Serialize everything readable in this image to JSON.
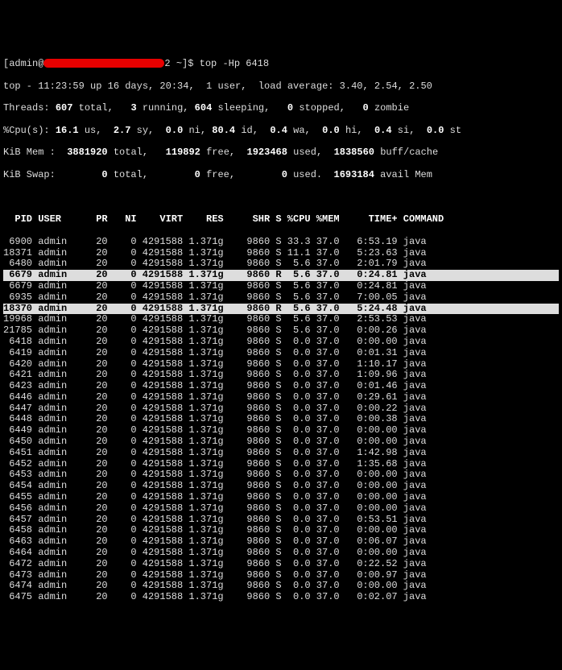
{
  "prompt": {
    "userhost": "[admin@",
    "tail": "2 ~]$ ",
    "cmd": "top -Hp 6418"
  },
  "summary": {
    "line1_a": "top - 11:23:59 up 16 days, 20:34,  1 user,  load average: 3.40, 2.54, 2.50",
    "threads_label": "Threads:",
    "threads_parts": {
      "total": "607",
      "total_l": "total,",
      "running": "3",
      "running_l": "running,",
      "sleeping": "604",
      "sleeping_l": "sleeping,",
      "stopped": "0",
      "stopped_l": "stopped,",
      "zombie": "0",
      "zombie_l": "zombie"
    },
    "cpu_label": "%Cpu(s):",
    "cpu_parts": {
      "us": "16.1",
      "us_l": "us,",
      "sy": "2.7",
      "sy_l": "sy,",
      "ni": "0.0",
      "ni_l": "ni,",
      "id": "80.4",
      "id_l": "id,",
      "wa": "0.4",
      "wa_l": "wa,",
      "hi": "0.0",
      "hi_l": "hi,",
      "si": "0.4",
      "si_l": "si,",
      "st": "0.0",
      "st_l": "st"
    },
    "mem_label": "KiB Mem :",
    "mem_parts": {
      "total": "3881920",
      "total_l": "total,",
      "free": "119892",
      "free_l": "free,",
      "used": "1923468",
      "used_l": "used,",
      "buff": "1838560",
      "buff_l": "buff/cache"
    },
    "swap_label": "KiB Swap:",
    "swap_parts": {
      "total": "0",
      "total_l": "total,",
      "free": "0",
      "free_l": "free,",
      "used": "0",
      "used_l": "used.",
      "avail": "1693184",
      "avail_l": "avail Mem"
    }
  },
  "columns": {
    "pid": "PID",
    "user": "USER",
    "pr": "PR",
    "ni": "NI",
    "virt": "VIRT",
    "res": "RES",
    "shr": "SHR",
    "s": "S",
    "cpu": "%CPU",
    "mem": "%MEM",
    "time": "TIME+",
    "cmd": "COMMAND"
  },
  "rows": [
    {
      "pid": "6900",
      "user": "admin",
      "pr": "20",
      "ni": "0",
      "virt": "4291588",
      "res": "1.371g",
      "shr": "9860",
      "s": "S",
      "cpu": "33.3",
      "mem": "37.0",
      "time": "6:53.19",
      "cmd": "java",
      "hl": false
    },
    {
      "pid": "18371",
      "user": "admin",
      "pr": "20",
      "ni": "0",
      "virt": "4291588",
      "res": "1.371g",
      "shr": "9860",
      "s": "S",
      "cpu": "11.1",
      "mem": "37.0",
      "time": "5:23.63",
      "cmd": "java",
      "hl": false
    },
    {
      "pid": "6480",
      "user": "admin",
      "pr": "20",
      "ni": "0",
      "virt": "4291588",
      "res": "1.371g",
      "shr": "9860",
      "s": "S",
      "cpu": "5.6",
      "mem": "37.0",
      "time": "2:01.79",
      "cmd": "java",
      "hl": false
    },
    {
      "pid": "6679",
      "user": "admin",
      "pr": "20",
      "ni": "0",
      "virt": "4291588",
      "res": "1.371g",
      "shr": "9860",
      "s": "R",
      "cpu": "5.6",
      "mem": "37.0",
      "time": "0:24.81",
      "cmd": "java",
      "hl": true
    },
    {
      "pid": "6679",
      "user": "admin",
      "pr": "20",
      "ni": "0",
      "virt": "4291588",
      "res": "1.371g",
      "shr": "9860",
      "s": "S",
      "cpu": "5.6",
      "mem": "37.0",
      "time": "0:24.81",
      "cmd": "java",
      "hl": false
    },
    {
      "pid": "6935",
      "user": "admin",
      "pr": "20",
      "ni": "0",
      "virt": "4291588",
      "res": "1.371g",
      "shr": "9860",
      "s": "S",
      "cpu": "5.6",
      "mem": "37.0",
      "time": "7:00.05",
      "cmd": "java",
      "hl": false
    },
    {
      "pid": "18370",
      "user": "admin",
      "pr": "20",
      "ni": "0",
      "virt": "4291588",
      "res": "1.371g",
      "shr": "9860",
      "s": "R",
      "cpu": "5.6",
      "mem": "37.0",
      "time": "5:24.48",
      "cmd": "java",
      "hl": true
    },
    {
      "pid": "19968",
      "user": "admin",
      "pr": "20",
      "ni": "0",
      "virt": "4291588",
      "res": "1.371g",
      "shr": "9860",
      "s": "S",
      "cpu": "5.6",
      "mem": "37.0",
      "time": "2:53.53",
      "cmd": "java",
      "hl": false
    },
    {
      "pid": "21785",
      "user": "admin",
      "pr": "20",
      "ni": "0",
      "virt": "4291588",
      "res": "1.371g",
      "shr": "9860",
      "s": "S",
      "cpu": "5.6",
      "mem": "37.0",
      "time": "0:00.26",
      "cmd": "java",
      "hl": false
    },
    {
      "pid": "6418",
      "user": "admin",
      "pr": "20",
      "ni": "0",
      "virt": "4291588",
      "res": "1.371g",
      "shr": "9860",
      "s": "S",
      "cpu": "0.0",
      "mem": "37.0",
      "time": "0:00.00",
      "cmd": "java",
      "hl": false
    },
    {
      "pid": "6419",
      "user": "admin",
      "pr": "20",
      "ni": "0",
      "virt": "4291588",
      "res": "1.371g",
      "shr": "9860",
      "s": "S",
      "cpu": "0.0",
      "mem": "37.0",
      "time": "0:01.31",
      "cmd": "java",
      "hl": false
    },
    {
      "pid": "6420",
      "user": "admin",
      "pr": "20",
      "ni": "0",
      "virt": "4291588",
      "res": "1.371g",
      "shr": "9860",
      "s": "S",
      "cpu": "0.0",
      "mem": "37.0",
      "time": "1:10.17",
      "cmd": "java",
      "hl": false
    },
    {
      "pid": "6421",
      "user": "admin",
      "pr": "20",
      "ni": "0",
      "virt": "4291588",
      "res": "1.371g",
      "shr": "9860",
      "s": "S",
      "cpu": "0.0",
      "mem": "37.0",
      "time": "1:09.96",
      "cmd": "java",
      "hl": false
    },
    {
      "pid": "6423",
      "user": "admin",
      "pr": "20",
      "ni": "0",
      "virt": "4291588",
      "res": "1.371g",
      "shr": "9860",
      "s": "S",
      "cpu": "0.0",
      "mem": "37.0",
      "time": "0:01.46",
      "cmd": "java",
      "hl": false
    },
    {
      "pid": "6446",
      "user": "admin",
      "pr": "20",
      "ni": "0",
      "virt": "4291588",
      "res": "1.371g",
      "shr": "9860",
      "s": "S",
      "cpu": "0.0",
      "mem": "37.0",
      "time": "0:29.61",
      "cmd": "java",
      "hl": false
    },
    {
      "pid": "6447",
      "user": "admin",
      "pr": "20",
      "ni": "0",
      "virt": "4291588",
      "res": "1.371g",
      "shr": "9860",
      "s": "S",
      "cpu": "0.0",
      "mem": "37.0",
      "time": "0:00.22",
      "cmd": "java",
      "hl": false
    },
    {
      "pid": "6448",
      "user": "admin",
      "pr": "20",
      "ni": "0",
      "virt": "4291588",
      "res": "1.371g",
      "shr": "9860",
      "s": "S",
      "cpu": "0.0",
      "mem": "37.0",
      "time": "0:00.38",
      "cmd": "java",
      "hl": false
    },
    {
      "pid": "6449",
      "user": "admin",
      "pr": "20",
      "ni": "0",
      "virt": "4291588",
      "res": "1.371g",
      "shr": "9860",
      "s": "S",
      "cpu": "0.0",
      "mem": "37.0",
      "time": "0:00.00",
      "cmd": "java",
      "hl": false
    },
    {
      "pid": "6450",
      "user": "admin",
      "pr": "20",
      "ni": "0",
      "virt": "4291588",
      "res": "1.371g",
      "shr": "9860",
      "s": "S",
      "cpu": "0.0",
      "mem": "37.0",
      "time": "0:00.00",
      "cmd": "java",
      "hl": false
    },
    {
      "pid": "6451",
      "user": "admin",
      "pr": "20",
      "ni": "0",
      "virt": "4291588",
      "res": "1.371g",
      "shr": "9860",
      "s": "S",
      "cpu": "0.0",
      "mem": "37.0",
      "time": "1:42.98",
      "cmd": "java",
      "hl": false
    },
    {
      "pid": "6452",
      "user": "admin",
      "pr": "20",
      "ni": "0",
      "virt": "4291588",
      "res": "1.371g",
      "shr": "9860",
      "s": "S",
      "cpu": "0.0",
      "mem": "37.0",
      "time": "1:35.68",
      "cmd": "java",
      "hl": false
    },
    {
      "pid": "6453",
      "user": "admin",
      "pr": "20",
      "ni": "0",
      "virt": "4291588",
      "res": "1.371g",
      "shr": "9860",
      "s": "S",
      "cpu": "0.0",
      "mem": "37.0",
      "time": "0:00.00",
      "cmd": "java",
      "hl": false
    },
    {
      "pid": "6454",
      "user": "admin",
      "pr": "20",
      "ni": "0",
      "virt": "4291588",
      "res": "1.371g",
      "shr": "9860",
      "s": "S",
      "cpu": "0.0",
      "mem": "37.0",
      "time": "0:00.00",
      "cmd": "java",
      "hl": false
    },
    {
      "pid": "6455",
      "user": "admin",
      "pr": "20",
      "ni": "0",
      "virt": "4291588",
      "res": "1.371g",
      "shr": "9860",
      "s": "S",
      "cpu": "0.0",
      "mem": "37.0",
      "time": "0:00.00",
      "cmd": "java",
      "hl": false
    },
    {
      "pid": "6456",
      "user": "admin",
      "pr": "20",
      "ni": "0",
      "virt": "4291588",
      "res": "1.371g",
      "shr": "9860",
      "s": "S",
      "cpu": "0.0",
      "mem": "37.0",
      "time": "0:00.00",
      "cmd": "java",
      "hl": false
    },
    {
      "pid": "6457",
      "user": "admin",
      "pr": "20",
      "ni": "0",
      "virt": "4291588",
      "res": "1.371g",
      "shr": "9860",
      "s": "S",
      "cpu": "0.0",
      "mem": "37.0",
      "time": "0:53.51",
      "cmd": "java",
      "hl": false
    },
    {
      "pid": "6458",
      "user": "admin",
      "pr": "20",
      "ni": "0",
      "virt": "4291588",
      "res": "1.371g",
      "shr": "9860",
      "s": "S",
      "cpu": "0.0",
      "mem": "37.0",
      "time": "0:00.00",
      "cmd": "java",
      "hl": false
    },
    {
      "pid": "6463",
      "user": "admin",
      "pr": "20",
      "ni": "0",
      "virt": "4291588",
      "res": "1.371g",
      "shr": "9860",
      "s": "S",
      "cpu": "0.0",
      "mem": "37.0",
      "time": "0:06.07",
      "cmd": "java",
      "hl": false
    },
    {
      "pid": "6464",
      "user": "admin",
      "pr": "20",
      "ni": "0",
      "virt": "4291588",
      "res": "1.371g",
      "shr": "9860",
      "s": "S",
      "cpu": "0.0",
      "mem": "37.0",
      "time": "0:00.00",
      "cmd": "java",
      "hl": false
    },
    {
      "pid": "6472",
      "user": "admin",
      "pr": "20",
      "ni": "0",
      "virt": "4291588",
      "res": "1.371g",
      "shr": "9860",
      "s": "S",
      "cpu": "0.0",
      "mem": "37.0",
      "time": "0:22.52",
      "cmd": "java",
      "hl": false
    },
    {
      "pid": "6473",
      "user": "admin",
      "pr": "20",
      "ni": "0",
      "virt": "4291588",
      "res": "1.371g",
      "shr": "9860",
      "s": "S",
      "cpu": "0.0",
      "mem": "37.0",
      "time": "0:00.97",
      "cmd": "java",
      "hl": false
    },
    {
      "pid": "6474",
      "user": "admin",
      "pr": "20",
      "ni": "0",
      "virt": "4291588",
      "res": "1.371g",
      "shr": "9860",
      "s": "S",
      "cpu": "0.0",
      "mem": "37.0",
      "time": "0:00.00",
      "cmd": "java",
      "hl": false
    },
    {
      "pid": "6475",
      "user": "admin",
      "pr": "20",
      "ni": "0",
      "virt": "4291588",
      "res": "1.371g",
      "shr": "9860",
      "s": "S",
      "cpu": "0.0",
      "mem": "37.0",
      "time": "0:02.07",
      "cmd": "java",
      "hl": false
    }
  ]
}
